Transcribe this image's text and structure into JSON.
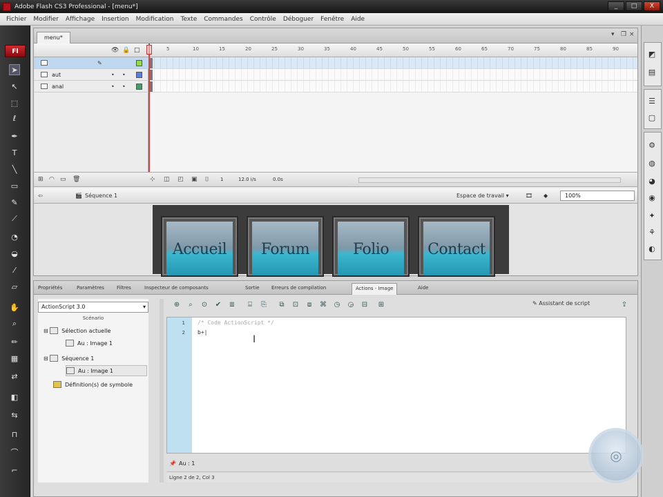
{
  "window": {
    "title": "Adobe Flash CS3 Professional - [menu*]",
    "min": "_",
    "max": "□",
    "close": "X"
  },
  "menu": [
    "Fichier",
    "Modifier",
    "Affichage",
    "Insertion",
    "Modification",
    "Texte",
    "Commandes",
    "Contrôle",
    "Déboguer",
    "Fenêtre",
    "Aide"
  ],
  "tools": {
    "logo": "Fl",
    "icons": [
      "selection-arrow-icon",
      "subselection-icon",
      "free-transform-icon",
      "lasso-icon",
      "pen-icon",
      "text-icon",
      "line-icon",
      "rectangle-icon",
      "pencil-icon",
      "brush-icon",
      "ink-bottle-icon",
      "paint-bucket-icon",
      "eyedropper-icon",
      "eraser-icon",
      "hand-icon",
      "zoom-icon",
      "stroke-color-icon",
      "fill-color-icon",
      "swap-colors-icon",
      "snap-icon"
    ]
  },
  "document": {
    "tab": "menu*",
    "timeline": {
      "frame_ticks": [
        "5",
        "10",
        "15",
        "20",
        "25",
        "30",
        "35",
        "40",
        "45",
        "50",
        "55",
        "60",
        "65",
        "70",
        "75",
        "80",
        "85",
        "90"
      ],
      "layers": [
        {
          "name": "",
          "selected": true,
          "color": "#9ad84e"
        },
        {
          "name": "aut",
          "selected": false,
          "color": "#5a7de0"
        },
        {
          "name": "anal",
          "selected": false,
          "color": "#4a9a6a"
        }
      ],
      "status": {
        "frame": "1",
        "fps": "12.0 i/s",
        "time": "0.0s"
      }
    },
    "editbar": {
      "scene": "Séquence 1",
      "workspace": "Espace de travail ▾",
      "zoom": "100%"
    },
    "stage_buttons": [
      "Accueil",
      "Forum",
      "Folio",
      "Contact"
    ]
  },
  "bottom_panel": {
    "tabs": [
      "Propriétés",
      "Paramètres",
      "Filtres",
      "Inspecteur de composants",
      "Sortie",
      "Erreurs de compilation",
      "Actions - Image",
      "Aide"
    ],
    "active_tab": "Actions - Image",
    "actionscript_version": "ActionScript 3.0",
    "toolbox_label": "Scénario",
    "tree": [
      {
        "label": "Sélection actuelle",
        "indent": 0
      },
      {
        "label": "Au : Image 1",
        "indent": 1
      },
      {
        "label": "Séquence 1",
        "indent": 0
      },
      {
        "label": "Au : Image 1",
        "indent": 1,
        "selected": true
      },
      {
        "label": "Définition(s) de symbole",
        "indent": 0
      }
    ],
    "assistant": "Assistant de script",
    "code": {
      "lines": [
        "1",
        "2"
      ],
      "line1": "/* Code ActionScript */",
      "line2": "b+|"
    },
    "script_tab": "Au : 1",
    "status": "Ligne 2 de 2, Col 3"
  }
}
